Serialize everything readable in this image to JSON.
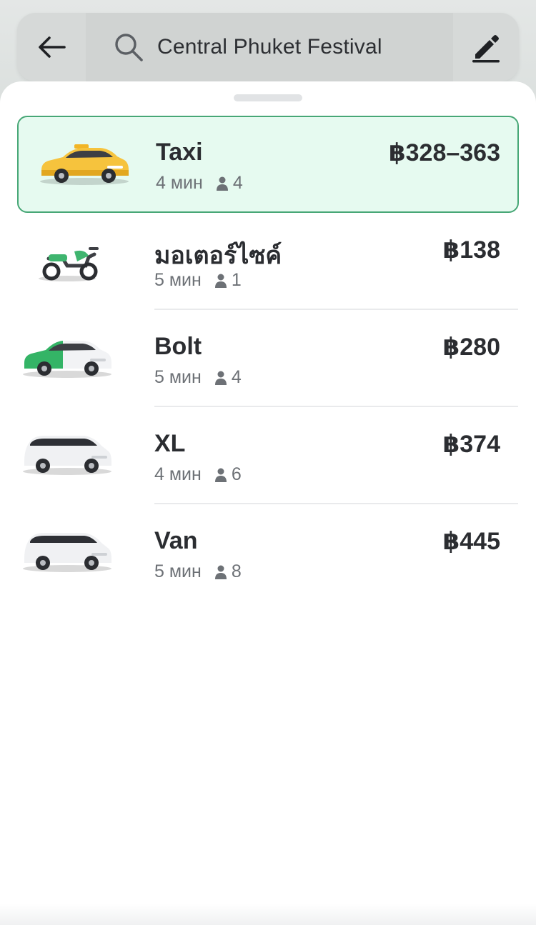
{
  "search": {
    "destination": "Central Phuket Festival"
  },
  "rides": [
    {
      "name": "Taxi",
      "eta": "4 мин",
      "seats": "4",
      "price": "฿328–363",
      "selected": true,
      "icon": "yellow-taxi-car"
    },
    {
      "name": "มอเตอร์ไซค์",
      "eta": "5 мин",
      "seats": "1",
      "price": "฿138",
      "selected": false,
      "icon": "green-motorbike"
    },
    {
      "name": "Bolt",
      "eta": "5 мин",
      "seats": "4",
      "price": "฿280",
      "selected": false,
      "icon": "green-white-car"
    },
    {
      "name": "XL",
      "eta": "4 мин",
      "seats": "6",
      "price": "฿374",
      "selected": false,
      "icon": "white-minivan"
    },
    {
      "name": "Van",
      "eta": "5 мин",
      "seats": "8",
      "price": "฿445",
      "selected": false,
      "icon": "white-minivan"
    }
  ],
  "colors": {
    "selected_bg": "#e6faf0",
    "selected_border": "#47a776",
    "taxi_yellow": "#f6c33d",
    "bolt_green": "#34b466"
  }
}
